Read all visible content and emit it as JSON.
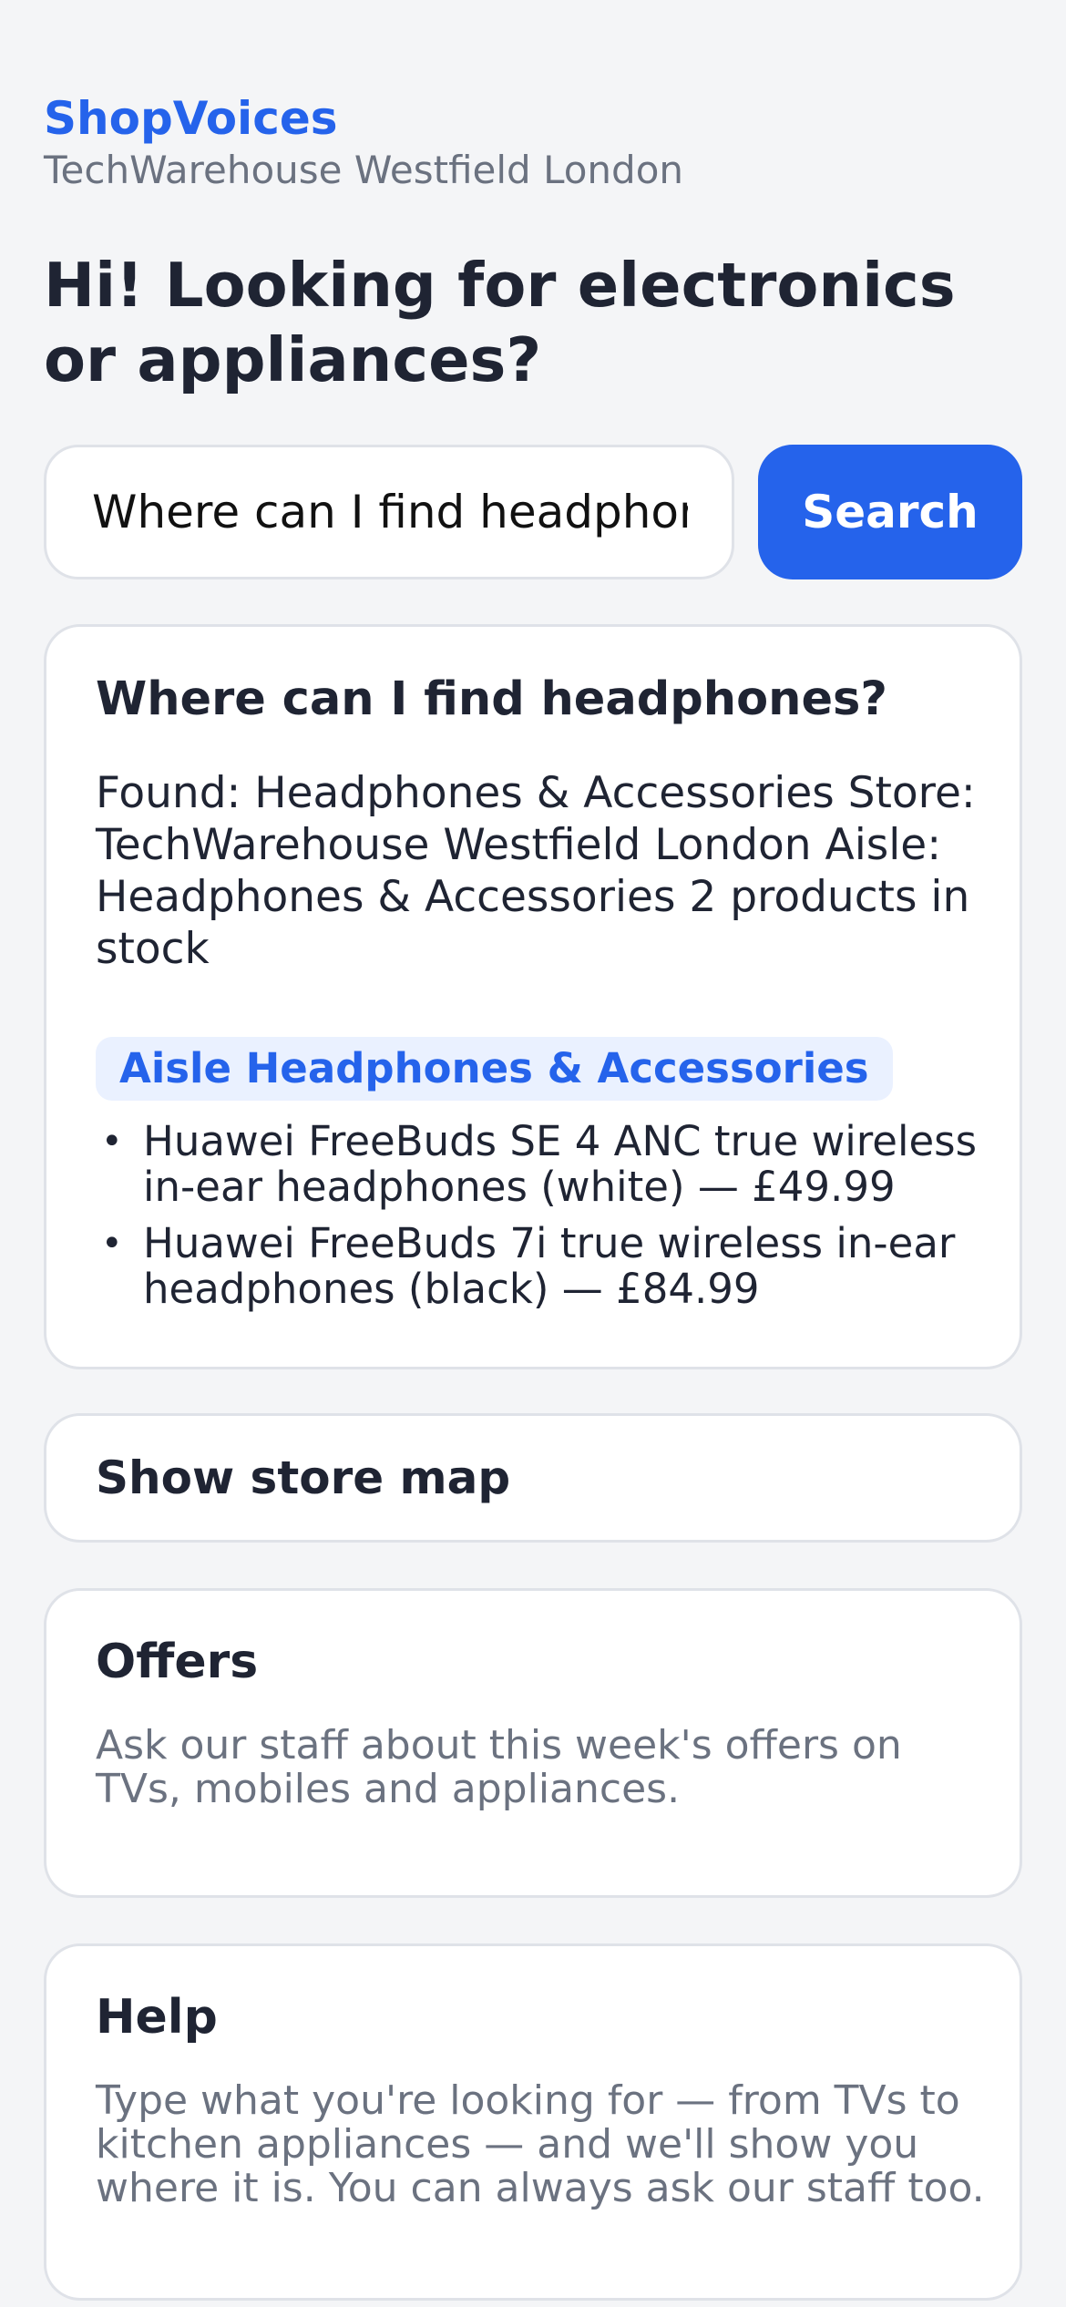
{
  "app": {
    "brand": "ShopVoices",
    "store_name": "TechWarehouse Westfield London"
  },
  "headline": "Hi! Looking for electronics or appliances?",
  "search": {
    "value": "Where can I find headphones?",
    "placeholder": "",
    "button_label": "Search"
  },
  "answer": {
    "question": "Where can I find headphones?",
    "body": "Found: Headphones & Accessories Store: TechWarehouse Westfield London Aisle: Headphones & Accessories 2 products in stock",
    "aisle_badge": "Aisle Headphones & Accessories",
    "products": [
      "Huawei FreeBuds SE 4 ANC true wireless in-ear headphones (white) — £49.99",
      "Huawei FreeBuds 7i true wireless in-ear headphones (black) — £84.99"
    ]
  },
  "map_button_label": "Show store map",
  "offers": {
    "title": "Offers",
    "text": "Ask our staff about this week's offers on TVs, mobiles and appliances."
  },
  "help": {
    "title": "Help",
    "text": "Type what you're looking for — from TVs to kitchen appliances — and we'll show you where it is. You can always ask our staff too."
  },
  "colors": {
    "accent": "#2563eb",
    "background": "#f4f5f7",
    "card": "#ffffff",
    "muted_text": "#6b7280",
    "badge_bg": "#eaf1ff"
  }
}
